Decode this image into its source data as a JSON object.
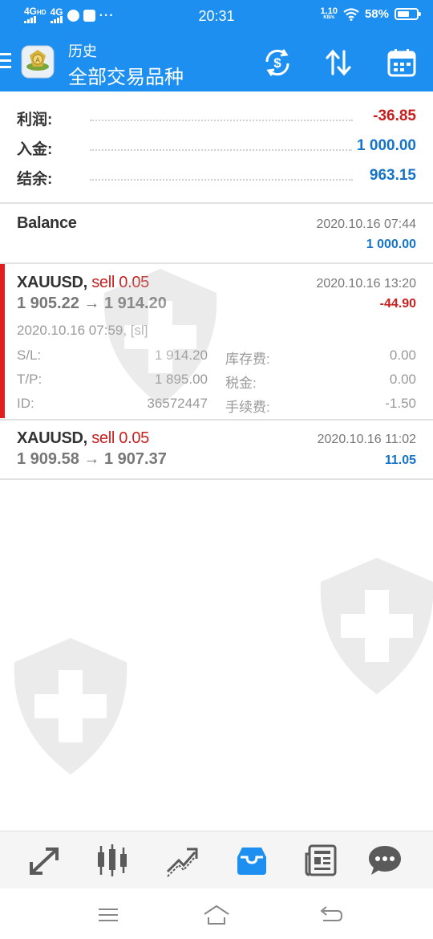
{
  "status_bar": {
    "net1": "4G",
    "net1_sup": "HD",
    "net2": "4G",
    "dots": "···",
    "time": "20:31",
    "speed": "1.10",
    "speed_unit": "KB/s",
    "battery": "58%"
  },
  "header": {
    "subtitle": "历史",
    "title": "全部交易品种",
    "icons": [
      "menu-icon",
      "mt-logo-icon",
      "currency-exchange-icon",
      "sort-icon",
      "calendar-icon"
    ],
    "background": "#1c8ff0"
  },
  "summary": {
    "profit_label": "利润:",
    "profit_value": "-36.85",
    "deposit_label": "入金:",
    "deposit_value": "1 000.00",
    "balance_label": "结余:",
    "balance_value": "963.15"
  },
  "balance_entry": {
    "title": "Balance",
    "time": "2020.10.16 07:44",
    "amount": "1 000.00"
  },
  "deals": [
    {
      "symbol": "XAUUSD,",
      "action": "sell 0.05",
      "time": "2020.10.16 13:20",
      "prices": "1 905.22 → 1 914.20",
      "profit": "-44.90",
      "open_time": "2020.10.16 07:59, [sl]",
      "sl_label": "S/L:",
      "sl_value": "1 914.20",
      "tp_label": "T/P:",
      "tp_value": "1 895.00",
      "id_label": "ID:",
      "id_value": "36572447",
      "swap_label": "库存费:",
      "swap_value": "0.00",
      "tax_label": "税金:",
      "tax_value": "0.00",
      "fee_label": "手续费:",
      "fee_value": "-1.50"
    },
    {
      "symbol": "XAUUSD,",
      "action": "sell 0.05",
      "time": "2020.10.16 11:02",
      "prices": "1 909.58 → 1 907.37",
      "profit": "11.05"
    }
  ],
  "colors": {
    "negative": "#c81f1f",
    "positive": "#1574c9",
    "accent": "#1c8ff0"
  },
  "bottom_nav": [
    "quotes-icon",
    "chart-icon",
    "trade-icon",
    "history-icon",
    "news-icon",
    "chat-icon"
  ],
  "system_nav": [
    "recents-icon",
    "home-icon",
    "back-icon"
  ]
}
